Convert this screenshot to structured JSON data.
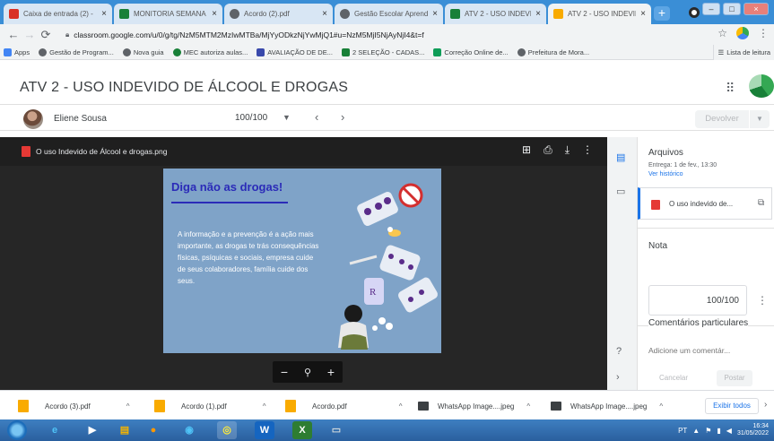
{
  "browser": {
    "tabs": [
      {
        "title": "Caixa de entrada (2) -",
        "icon": "gmail-icon",
        "color": "#d93025",
        "active": false
      },
      {
        "title": "MONITORIA SEMANA",
        "icon": "sheets-icon",
        "color": "#188038",
        "active": false
      },
      {
        "title": "Acordo (2).pdf",
        "icon": "globe-icon",
        "color": "#5f6368",
        "active": false
      },
      {
        "title": "Gestão Escolar Aprendiz",
        "icon": "globe-icon",
        "color": "#5f6368",
        "active": false
      },
      {
        "title": "ATV 2 - USO INDEVIDO",
        "icon": "classroom-icon",
        "color": "#188038",
        "active": false
      },
      {
        "title": "ATV 2 - USO INDEVIDO",
        "icon": "classroom-icon",
        "color": "#f9ab00",
        "active": true
      }
    ],
    "tab_close_glyph": "×",
    "new_tab_glyph": "+",
    "window_controls": [
      "–",
      "□",
      "×"
    ],
    "url": "classroom.google.com/u/0/g/tg/NzM5MTM2MzIwMTBa/MjYyODkzNjYwMjQ1#u=NzM5MjI5NjAyNjI4&t=f",
    "bookmarks": [
      {
        "label": "Apps",
        "color": "#4285f4"
      },
      {
        "label": "Gestão de Program...",
        "color": "#5f6368"
      },
      {
        "label": "Nova guia",
        "color": "#5f6368"
      },
      {
        "label": "MEC autoriza aulas...",
        "color": "#188038"
      },
      {
        "label": "AVALIAÇÃO DE DE...",
        "color": "#3949ab"
      },
      {
        "label": "2 SELEÇÃO - CADAS...",
        "color": "#188038"
      },
      {
        "label": "Correção Online de...",
        "color": "#0f9d58"
      },
      {
        "label": "Prefeitura de Mora...",
        "color": "#1565c0"
      }
    ],
    "reading_list": "Lista de leitura"
  },
  "classroom": {
    "title": "ATV 2 - USO INDEVIDO DE ÁLCOOL E DROGAS",
    "student_name": "Eliene Sousa",
    "grade_display": "100/100",
    "return_label": "Devolver",
    "colors": {
      "primary": "#1a73e8",
      "pdf_red": "#e53935"
    }
  },
  "viewer": {
    "file_name": "O uso Indevido de Álcool e drogas.png",
    "slide": {
      "heading": "Diga não as drogas!",
      "body": "A informação e a prevenção é a ação mais importante, as drogas te trás consequências físicas, psíquicas e sociais, empresa cuide de seus colaboradores, família cuide dos seus.",
      "background": "#7fa3c8"
    },
    "zoom_out": "−",
    "zoom_in": "+"
  },
  "side_panel": {
    "files_title": "Arquivos",
    "due": "Entrega: 1 de fev., 13:30",
    "history_link": "Ver histórico",
    "attachment": "O uso indevido de...",
    "grade_title": "Nota",
    "grade_value": "100/100",
    "comments_title": "Comentários particulares",
    "comment_placeholder": "Adicione um comentár...",
    "cancel": "Cancelar",
    "post": "Postar"
  },
  "downloads": {
    "items": [
      {
        "name": "Acordo (3).pdf",
        "color": "#f9ab00"
      },
      {
        "name": "Acordo (1).pdf",
        "color": "#f9ab00"
      },
      {
        "name": "Acordo.pdf",
        "color": "#f9ab00"
      },
      {
        "name": "WhatsApp Image....jpeg",
        "color": "#3c4043"
      },
      {
        "name": "WhatsApp Image....jpeg",
        "color": "#3c4043"
      }
    ],
    "show_all": "Exibir todos"
  },
  "taskbar": {
    "apps": [
      {
        "label": "e",
        "color": "#1e88e5"
      },
      {
        "label": "▶",
        "color": "#2196f3"
      },
      {
        "label": "▤",
        "color": "#f5b400"
      },
      {
        "label": "●",
        "color": "#e65100"
      },
      {
        "label": "◉",
        "color": "#0288d1"
      },
      {
        "label": "◎",
        "color": "#43a047"
      },
      {
        "label": "W",
        "color": "#1565c0"
      },
      {
        "label": "X",
        "color": "#2e7d32"
      },
      {
        "label": "▭",
        "color": "#546e7a"
      }
    ],
    "lang": "PT",
    "time": "16:34",
    "date": "31/05/2022"
  }
}
